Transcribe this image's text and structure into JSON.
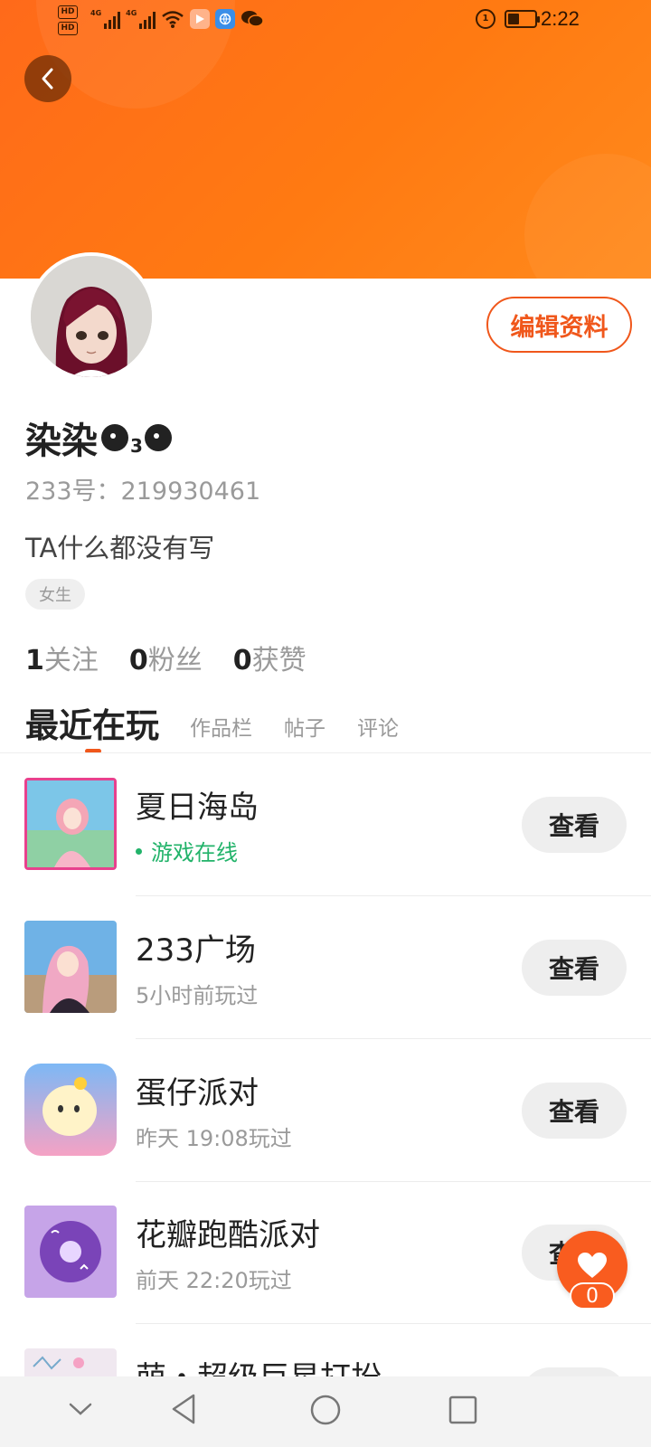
{
  "status_bar": {
    "time": "2:22",
    "hd1": "HD",
    "hd2": "HD",
    "net1": "4G",
    "net2": "4G",
    "ring_label": "1"
  },
  "profile": {
    "nickname": "染染",
    "nickname_sub": "3",
    "uid": "233号：219930461",
    "bio": "TA什么都没有写",
    "gender_tag": "女生",
    "edit_button": "编辑资料"
  },
  "stats": [
    {
      "num": "1",
      "label": "关注"
    },
    {
      "num": "0",
      "label": "粉丝"
    },
    {
      "num": "0",
      "label": "获赞"
    }
  ],
  "tabs": {
    "active": "最近在玩",
    "others": [
      "作品栏",
      "帖子",
      "评论"
    ]
  },
  "games": [
    {
      "name": "夏日海岛",
      "status": "游戏在线",
      "button": "查看"
    },
    {
      "name": "233广场",
      "status": "5小时前玩过",
      "button": "查看"
    },
    {
      "name": "蛋仔派对",
      "status": "昨天 19:08玩过",
      "button": "查看"
    },
    {
      "name": "花瓣跑酷派对",
      "status": "前天 22:20玩过",
      "button": "查看"
    },
    {
      "name": "萌・超级巨星打扮",
      "status": "",
      "button": "查看"
    }
  ],
  "like_fab": {
    "count": "0"
  },
  "colors": {
    "accent": "#f0571b",
    "header": "#ff7a12",
    "online": "#22b36a"
  }
}
